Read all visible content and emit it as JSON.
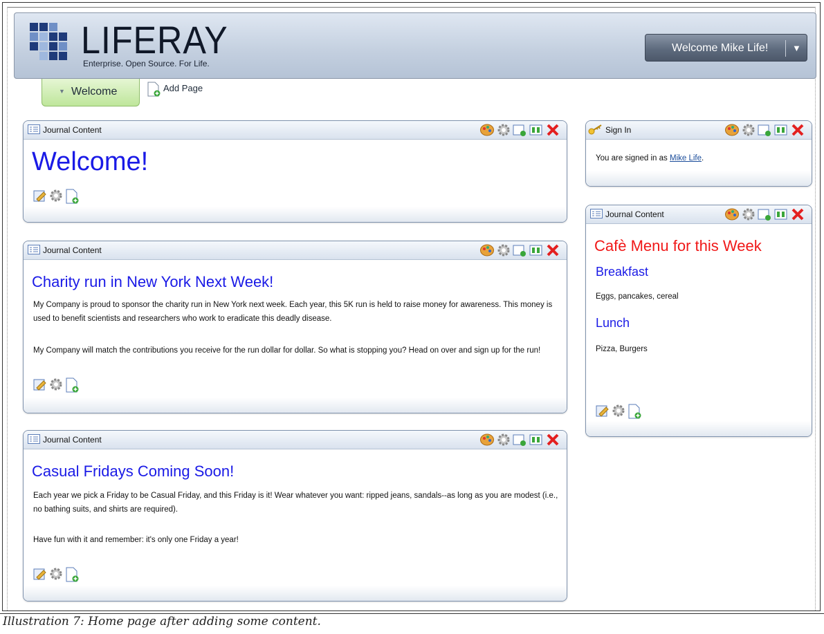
{
  "header": {
    "logo_text": "LIFERAY",
    "tagline": "Enterprise. Open Source. For Life.",
    "welcome_button": "Welcome Mike Life!",
    "colors": {
      "header_bg": "#c3cfdf",
      "button_bg": "#5e6b7e",
      "logo_dark": "#1f3b7a",
      "logo_light": "#9fb8de"
    }
  },
  "nav": {
    "tab_label": "Welcome",
    "add_page_label": "Add Page"
  },
  "portlet_tools": [
    "look-and-feel-icon",
    "configuration-icon",
    "minimize-icon",
    "maximize-icon",
    "close-icon"
  ],
  "portlets": {
    "welcome": {
      "title": "Journal Content",
      "heading": "Welcome!"
    },
    "charity": {
      "title": "Journal Content",
      "heading": "Charity run in New York Next Week!",
      "para1": "My Company is proud to sponsor the charity run in New York next week. Each year, this 5K run is held to raise money for awareness. This money is used to benefit scientists and researchers who work to eradicate this deadly disease.",
      "para2": "My Company will match the contributions you receive for the run dollar for dollar. So what is stopping you? Head on over and sign up for the run!"
    },
    "casual": {
      "title": "Journal Content",
      "heading": "Casual Fridays Coming Soon!",
      "para1": "Each year we pick a Friday to be Casual Friday, and this Friday is it! Wear whatever you want: ripped jeans, sandals--as long as you are modest (i.e., no bathing suits, and shirts are required).",
      "para2": "Have fun with it and remember: it's only one Friday a year!"
    },
    "signin": {
      "title": "Sign In",
      "text_prefix": "You are signed in as",
      "user_link": "Mike Life",
      "text_suffix": "."
    },
    "cafe": {
      "title": "Journal Content",
      "heading": "Cafè Menu for this Week",
      "breakfast_heading": "Breakfast",
      "breakfast_items": "Eggs, pancakes, cereal",
      "lunch_heading": "Lunch",
      "lunch_items": "Pizza, Burgers"
    }
  },
  "caption": "Illustration 7: Home page after adding some content."
}
